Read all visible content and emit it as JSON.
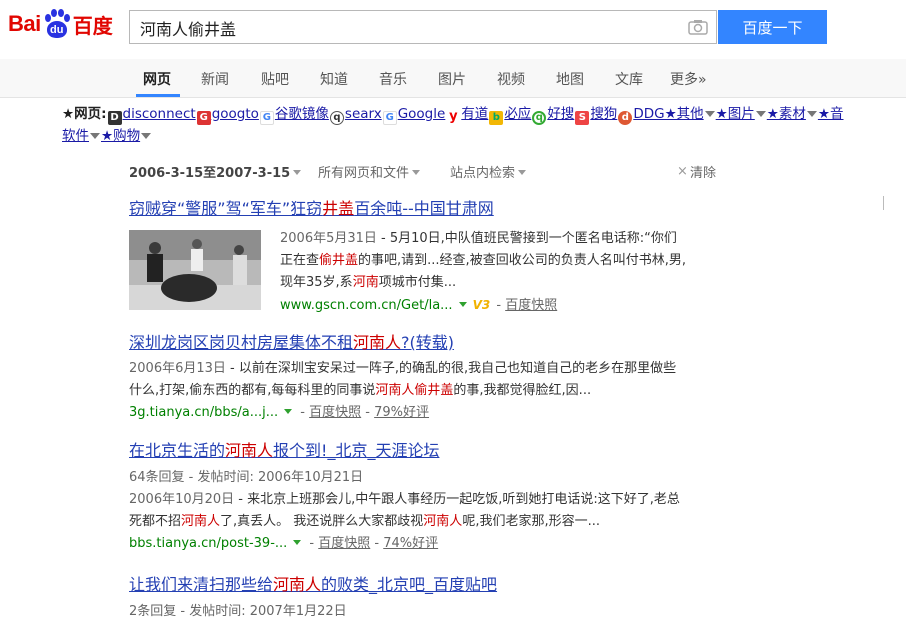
{
  "logo": {
    "bai": "Bai",
    "du": "du",
    "cn": "百度"
  },
  "search": {
    "query": "河南人偷井盖",
    "button": "百度一下"
  },
  "tabs": [
    "网页",
    "新闻",
    "贴吧",
    "知道",
    "音乐",
    "图片",
    "视频",
    "地图",
    "文库",
    "更多»"
  ],
  "bookmarks": {
    "line1_prefix": "★网页:",
    "items": [
      "disconnect",
      "googto",
      "谷歌镜像",
      "searx",
      "Google",
      "有道",
      "必应",
      "好搜",
      "搜狗",
      "DDG★其他",
      "★图片",
      "★素材",
      "★音"
    ],
    "line2": [
      "软件",
      "★购物"
    ]
  },
  "filters": {
    "date_range": "2006-3-15至2007-3-15",
    "scope": "所有网页和文件",
    "site": "站点内检索",
    "clear": "清除"
  },
  "results": [
    {
      "title_pre": "窃贼穿“警服”驾“军车”狂窃",
      "title_hl": "井盖",
      "title_post": "百余吨--中国甘肃网",
      "date": "2006年5月31日",
      "abs1_a": " - 5月10日,中队值班民警接到一个匿名电话称:“你们",
      "abs2_a": "正在查",
      "abs2_hl": "偷井盖",
      "abs2_b": "的事吧,请到...经查,被查回收公司的负责人名叫付书林,男,",
      "abs3_a": "现年35岁,系",
      "abs3_hl": "河南",
      "abs3_b": "项城市付集...",
      "url": "www.gscn.com.cn/Get/la...",
      "badge": "V3",
      "snapshot": "百度快照"
    },
    {
      "title_pre": "深圳龙岗区岗贝村房屋集体不租",
      "title_hl": "河南人",
      "title_post": "?(转载)",
      "date": "2006年6月13日",
      "abs1_a": " - 以前在深圳宝安呆过一阵子,的确乱的很,我自己也知道自己的老乡在那里做些",
      "abs2_a": "什么,打架,偷东西的都有,每每科里的同事说",
      "abs2_hl": "河南人偷井盖",
      "abs2_b": "的事,我都觉得脸红,因...",
      "url": "3g.tianya.cn/bbs/a...j...",
      "snapshot": "百度快照",
      "rating": "79%好评"
    },
    {
      "title_pre": "在北京生活的",
      "title_hl": "河南人",
      "title_post": "报个到!_北京_天涯论坛",
      "meta": "64条回复 - 发帖时间: 2006年10月21日",
      "date": "2006年10月20日",
      "abs1_a": " - 来北京上班那会儿,中午跟人事经历一起吃饭,听到她打电话说:这下好了,老总",
      "abs2_a": "死都不招",
      "abs2_hl": "河南人",
      "abs2_b": "了,真丢人。 我还说胖么大家都歧视",
      "abs2_hl2": "河南人",
      "abs2_c": "呢,我们老家那,形容一...",
      "url": "bbs.tianya.cn/post-39-...",
      "snapshot": "百度快照",
      "rating": "74%好评"
    },
    {
      "title_pre": "让我们来清扫那些给",
      "title_hl": "河南人",
      "title_post": "的败类_北京吧_百度贴吧",
      "meta": "2条回复 - 发帖时间: 2007年1月22日"
    }
  ]
}
